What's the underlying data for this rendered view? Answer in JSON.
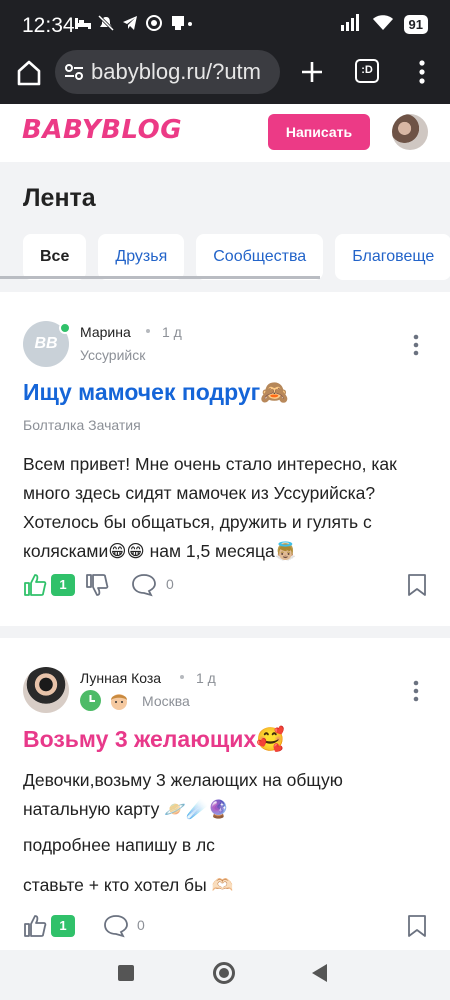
{
  "status_bar": {
    "time": "12:34",
    "battery": "91"
  },
  "browser": {
    "url": "babyblog.ru/?utm",
    "tab_count": ":D"
  },
  "site": {
    "logo": "BABYBLOG",
    "write_button": "Написать"
  },
  "feed": {
    "title": "Лента",
    "tabs": [
      {
        "label": "Все",
        "active": true
      },
      {
        "label": "Друзья",
        "active": false
      },
      {
        "label": "Сообщества",
        "active": false
      },
      {
        "label": "Благовеще",
        "active": false
      }
    ]
  },
  "posts": [
    {
      "avatar_text": "BB",
      "author": "Марина",
      "time": "1 д",
      "city": "Уссурийск",
      "title": "Ищу мамочек подруг🙈",
      "community": "Болталка Зачатия",
      "body": [
        "Всем привет! Мне очень стало интересно, как много здесь сидят мамочек из Уссурийска? Хотелось бы общаться, дружить и гулять с колясками😁😁 нам 1,5 месяца👼🏼"
      ],
      "likes": "1",
      "comments": "0"
    },
    {
      "author": "Лунная Коза",
      "time": "1 д",
      "city": "Москва",
      "title": "Возьму 3 желающих🥰",
      "body": [
        "Девочки,возьму 3 желающих на общую натальную карту 🪐☄️🔮",
        "подробнее напишу в лс",
        "ставьте + кто хотел бы 🫶🏻"
      ],
      "likes": "1",
      "comments": "0"
    }
  ],
  "colors": {
    "brand_pink": "#ec3a86",
    "link_blue": "#1565d8",
    "like_green": "#30c16a"
  }
}
